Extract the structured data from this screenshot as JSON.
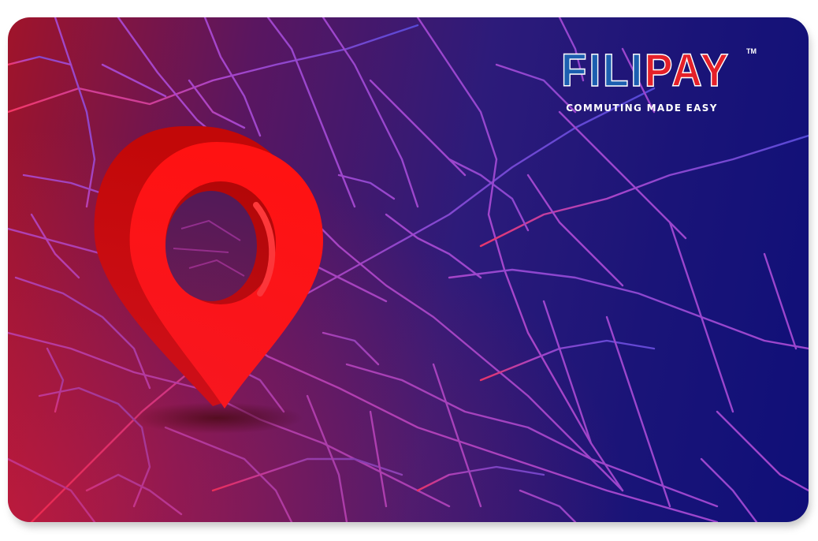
{
  "brand": {
    "name_part1": "FILI",
    "name_part2": "PAY",
    "trademark": "TM",
    "tagline": "COMMUTING MADE EASY"
  },
  "colors": {
    "brand_blue": "#1c5fb0",
    "brand_red": "#e52029",
    "pin_red": "#ff1212",
    "pin_dark": "#c20808"
  },
  "icons": {
    "location_pin": "map-pin-icon"
  }
}
